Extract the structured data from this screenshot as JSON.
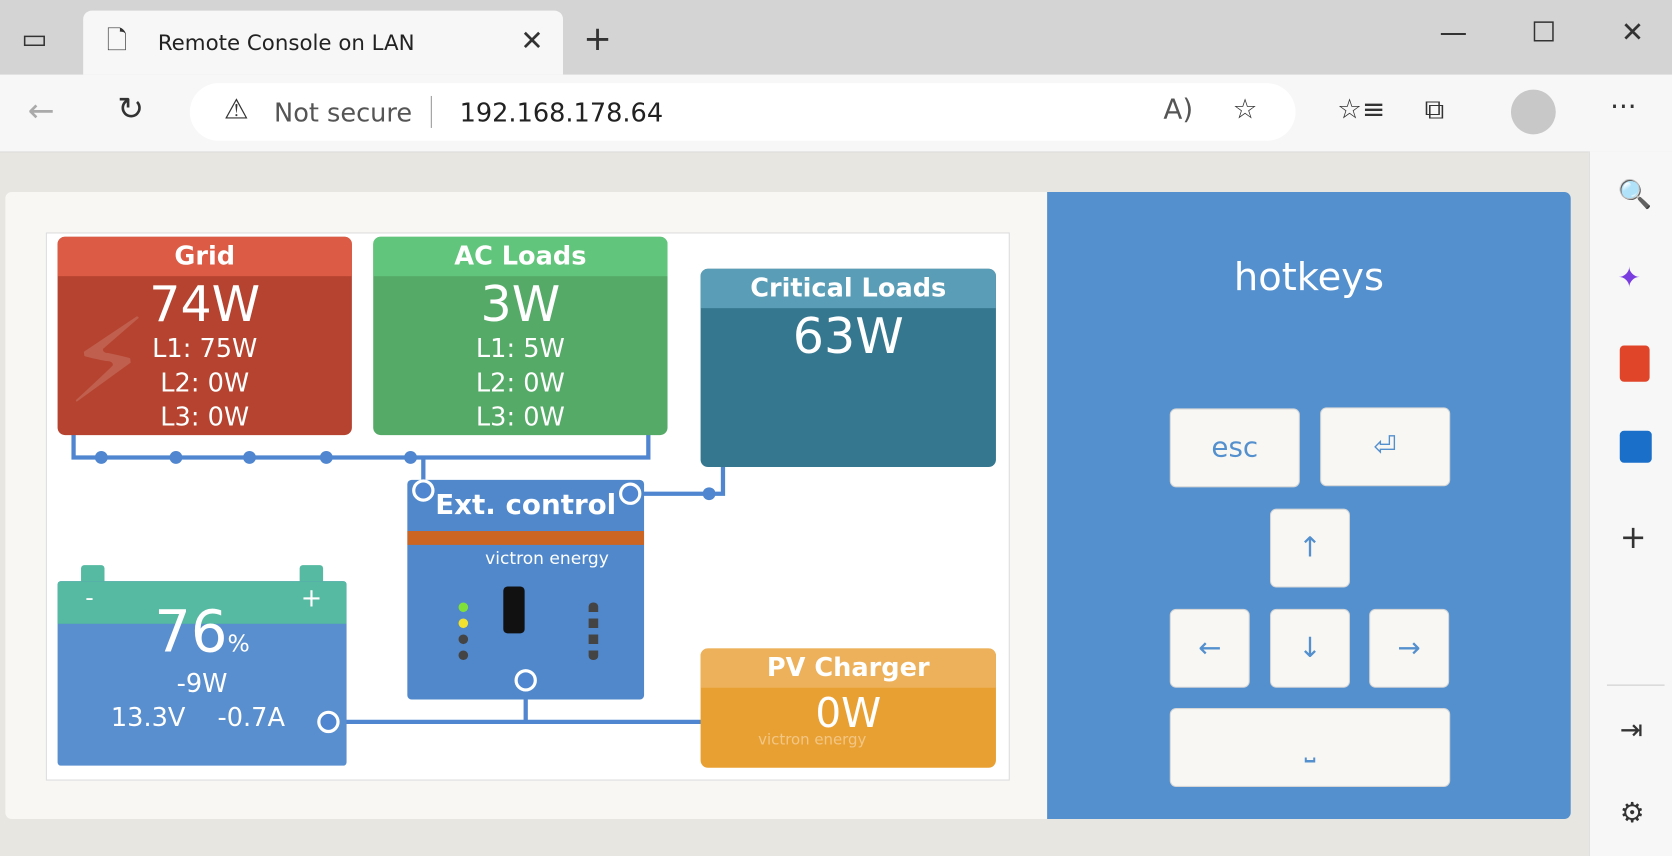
{
  "browser": {
    "tab_title": "Remote Console on LAN",
    "security_label": "Not secure",
    "url": "192.168.178.64",
    "icons": [
      "tab-actions-icon",
      "page-icon",
      "close-icon",
      "new-tab-icon",
      "minimize-icon",
      "maximize-icon",
      "window-close-icon",
      "back-icon",
      "refresh-icon",
      "warning-icon",
      "read-aloud-icon",
      "add-favorite-icon",
      "favorites-icon",
      "collections-icon",
      "profile-icon",
      "more-icon"
    ],
    "sidebar_icons": [
      "search-icon",
      "copilot-icon",
      "office-icon",
      "outlook-icon",
      "add-icon",
      "split-screen-icon",
      "settings-icon"
    ]
  },
  "overview": {
    "grid": {
      "title": "Grid",
      "total": "74W",
      "l1": "L1: 75W",
      "l2": "L2: 0W",
      "l3": "L3: 0W"
    },
    "ac_loads": {
      "title": "AC Loads",
      "total": "3W",
      "l1": "L1: 5W",
      "l2": "L2: 0W",
      "l3": "L3: 0W"
    },
    "critical_loads": {
      "title": "Critical Loads",
      "total": "63W"
    },
    "inverter": {
      "title": "Ext. control",
      "brand": "victron energy"
    },
    "battery": {
      "soc": "76",
      "unit": "%",
      "power": "-9W",
      "voltage": "13.3V",
      "current": "-0.7A",
      "minus": "-",
      "plus": "+"
    },
    "pv_charger": {
      "title": "PV Charger",
      "power": "0W",
      "brand": "victron energy"
    }
  },
  "hotkeys": {
    "title": "hotkeys",
    "esc": "esc",
    "enter": "⏎",
    "up": "↑",
    "left": "←",
    "down": "↓",
    "right": "→",
    "space": "⎵"
  },
  "colors": {
    "grid": "#b5432f",
    "ac_loads": "#56aa68",
    "critical": "#367790",
    "inverter": "#5088cb",
    "battery": "#5a8fcf",
    "pv": "#e9a032",
    "hotkeys_bg": "#5490ce"
  }
}
